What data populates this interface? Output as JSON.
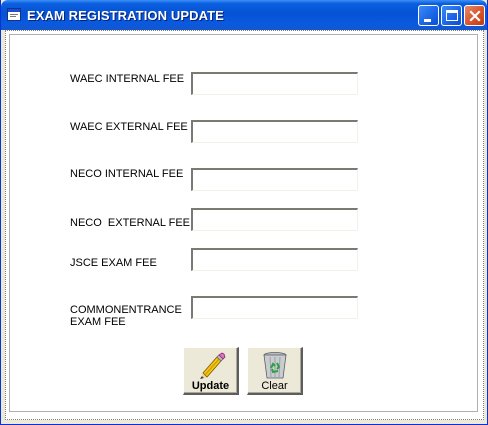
{
  "window": {
    "title": "EXAM REGISTRATION UPDATE",
    "controls": [
      "minimize-icon",
      "maximize-icon",
      "close-icon"
    ]
  },
  "form": {
    "fields": [
      {
        "label": "WAEC INTERNAL FEE",
        "value": ""
      },
      {
        "label": "WAEC EXTERNAL FEE",
        "value": ""
      },
      {
        "label": "NECO INTERNAL FEE",
        "value": ""
      },
      {
        "label": "NECO  EXTERNAL FEE",
        "value": ""
      },
      {
        "label": "JSCE EXAM FEE",
        "value": ""
      },
      {
        "label": "COMMONENTRANCE\nEXAM FEE",
        "value": ""
      }
    ]
  },
  "buttons": {
    "update": {
      "label": "Update",
      "icon": "pencil-icon"
    },
    "clear": {
      "label": "Clear",
      "icon": "recycle-bin-icon"
    }
  },
  "colors": {
    "titlebar": "#0553d4",
    "window_bg": "#ece9d8",
    "close_button": "#d9532b"
  }
}
